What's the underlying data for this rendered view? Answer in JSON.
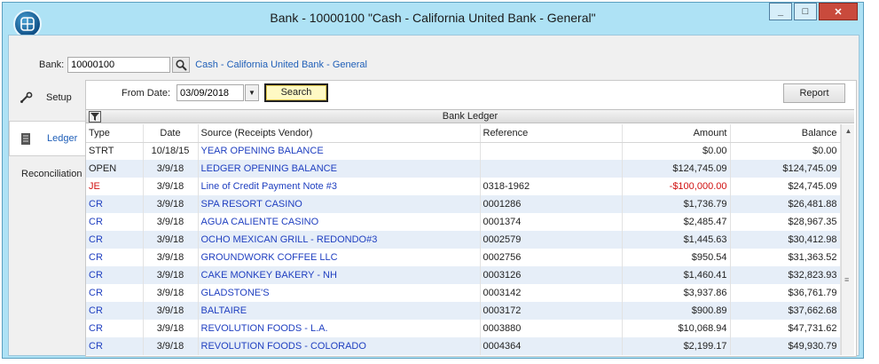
{
  "window": {
    "title": "Bank - 10000100 \"Cash - California United Bank - General\"",
    "controls": {
      "minimize": "_",
      "maximize": "□",
      "close": "✕"
    }
  },
  "bank": {
    "label": "Bank:",
    "value": "10000100",
    "description": "Cash - California United Bank - General"
  },
  "side_tabs": [
    {
      "label": "Setup",
      "icon": "wrench-icon"
    },
    {
      "label": "Ledger",
      "icon": "ledger-icon",
      "active": true
    },
    {
      "label": "Reconciliation"
    }
  ],
  "filters": {
    "from_label": "From Date:",
    "from_value": "03/09/2018",
    "search_label": "Search",
    "report_label": "Report"
  },
  "grid": {
    "title": "Bank Ledger",
    "columns": [
      "Type",
      "Date",
      "Source (Receipts Vendor)",
      "Reference",
      "Amount",
      "Balance"
    ],
    "rows": [
      [
        "STRT",
        "10/18/15",
        "YEAR OPENING BALANCE",
        "",
        "$0.00",
        "$0.00"
      ],
      [
        "OPEN",
        "3/9/18",
        "LEDGER OPENING BALANCE",
        "",
        "$124,745.09",
        "$124,745.09"
      ],
      [
        "JE",
        "3/9/18",
        "Line of Credit Payment Note #3",
        "0318-1962",
        "-$100,000.00",
        "$24,745.09"
      ],
      [
        "CR",
        "3/9/18",
        "SPA RESORT CASINO",
        "0001286",
        "$1,736.79",
        "$26,481.88"
      ],
      [
        "CR",
        "3/9/18",
        "AGUA CALIENTE CASINO",
        "0001374",
        "$2,485.47",
        "$28,967.35"
      ],
      [
        "CR",
        "3/9/18",
        "OCHO MEXICAN GRILL - REDONDO#3",
        "0002579",
        "$1,445.63",
        "$30,412.98"
      ],
      [
        "CR",
        "3/9/18",
        "GROUNDWORK COFFEE LLC",
        "0002756",
        "$950.54",
        "$31,363.52"
      ],
      [
        "CR",
        "3/9/18",
        "CAKE MONKEY BAKERY - NH",
        "0003126",
        "$1,460.41",
        "$32,823.93"
      ],
      [
        "CR",
        "3/9/18",
        "GLADSTONE'S",
        "0003142",
        "$3,937.86",
        "$36,761.79"
      ],
      [
        "CR",
        "3/9/18",
        "BALTAIRE",
        "0003172",
        "$900.89",
        "$37,662.68"
      ],
      [
        "CR",
        "3/9/18",
        "REVOLUTION FOODS - L.A.",
        "0003880",
        "$10,068.94",
        "$47,731.62"
      ],
      [
        "CR",
        "3/9/18",
        "REVOLUTION FOODS - COLORADO",
        "0004364",
        "$2,199.17",
        "$49,930.79"
      ]
    ]
  },
  "colors": {
    "link": "#1f3fc0",
    "negative": "#d01010",
    "alt_row": "#e6eef8",
    "titlebar": "#aee2f5",
    "search_highlight": "#fff9c4"
  }
}
